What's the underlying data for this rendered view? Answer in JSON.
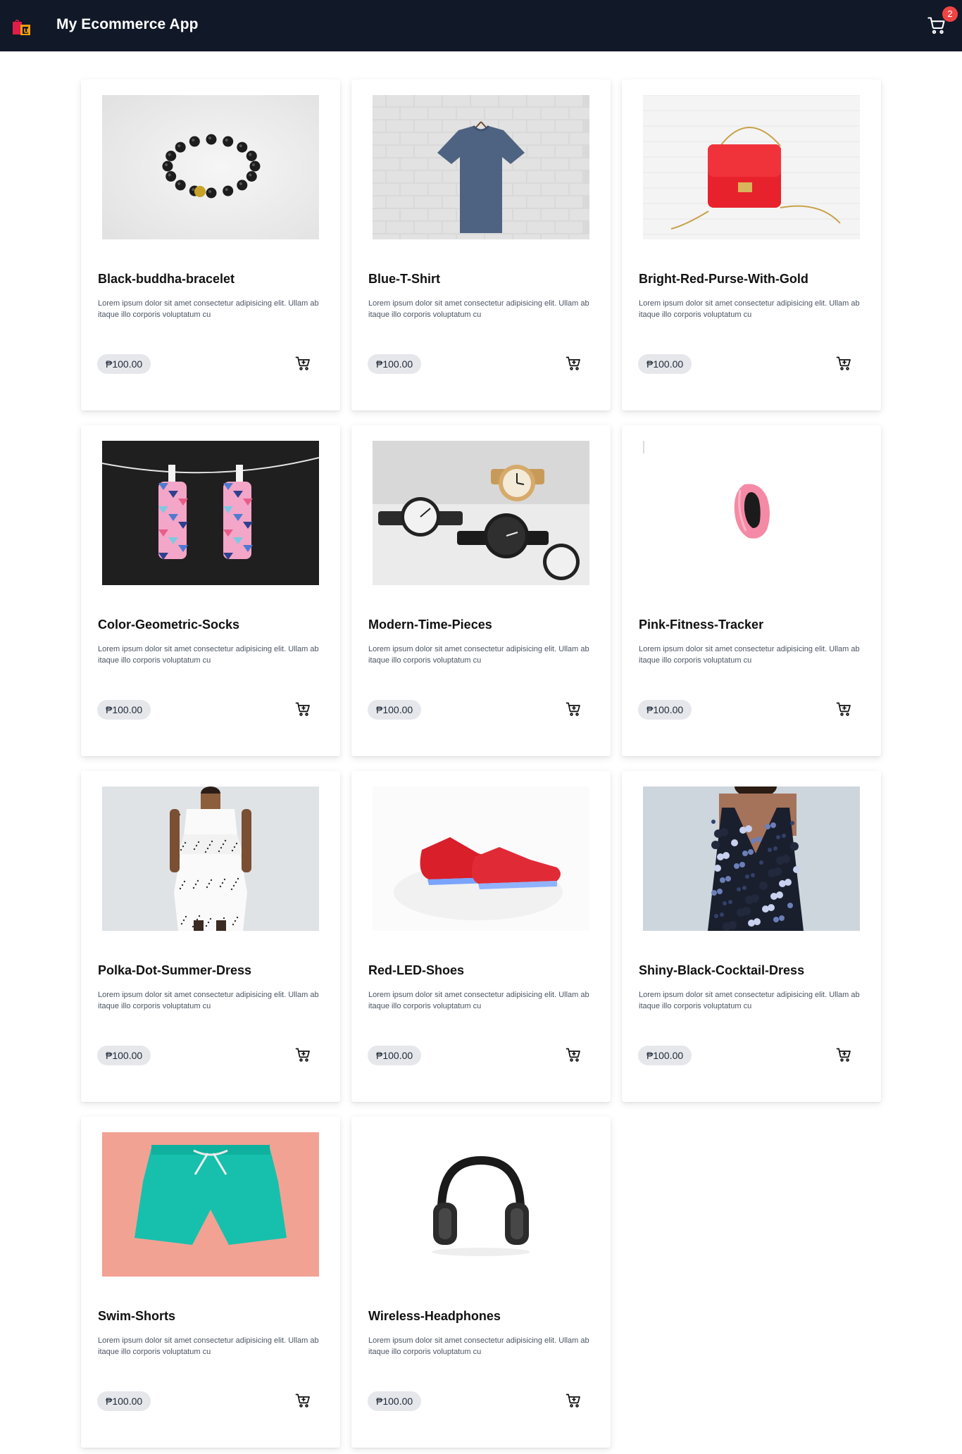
{
  "header": {
    "app_title": "My Ecommerce App",
    "cart_count": "2",
    "colors": {
      "background": "#111827",
      "badge": "#ef4444"
    }
  },
  "products": [
    {
      "name": "Black-buddha-bracelet",
      "description": "Lorem ipsum dolor sit amet consectetur adipisicing elit. Ullam ab itaque illo corporis voluptatum cu",
      "price": "₱100.00",
      "image_icon": "bracelet-image"
    },
    {
      "name": "Blue-T-Shirt",
      "description": "Lorem ipsum dolor sit amet consectetur adipisicing elit. Ullam ab itaque illo corporis voluptatum cu",
      "price": "₱100.00",
      "image_icon": "tshirt-image"
    },
    {
      "name": "Bright-Red-Purse-With-Gold",
      "description": "Lorem ipsum dolor sit amet consectetur adipisicing elit. Ullam ab itaque illo corporis voluptatum cu",
      "price": "₱100.00",
      "image_icon": "purse-image"
    },
    {
      "name": "Color-Geometric-Socks",
      "description": "Lorem ipsum dolor sit amet consectetur adipisicing elit. Ullam ab itaque illo corporis voluptatum cu",
      "price": "₱100.00",
      "image_icon": "socks-image"
    },
    {
      "name": "Modern-Time-Pieces",
      "description": "Lorem ipsum dolor sit amet consectetur adipisicing elit. Ullam ab itaque illo corporis voluptatum cu",
      "price": "₱100.00",
      "image_icon": "watches-image"
    },
    {
      "name": "Pink-Fitness-Tracker",
      "description": "Lorem ipsum dolor sit amet consectetur adipisicing elit. Ullam ab itaque illo corporis voluptatum cu",
      "price": "₱100.00",
      "image_icon": "fitness-tracker-image"
    },
    {
      "name": "Polka-Dot-Summer-Dress",
      "description": "Lorem ipsum dolor sit amet consectetur adipisicing elit. Ullam ab itaque illo corporis voluptatum cu",
      "price": "₱100.00",
      "image_icon": "dress-image"
    },
    {
      "name": "Red-LED-Shoes",
      "description": "Lorem ipsum dolor sit amet consectetur adipisicing elit. Ullam ab itaque illo corporis voluptatum cu",
      "price": "₱100.00",
      "image_icon": "shoes-image"
    },
    {
      "name": "Shiny-Black-Cocktail-Dress",
      "description": "Lorem ipsum dolor sit amet consectetur adipisicing elit. Ullam ab itaque illo corporis voluptatum cu",
      "price": "₱100.00",
      "image_icon": "cocktail-dress-image"
    },
    {
      "name": "Swim-Shorts",
      "description": "Lorem ipsum dolor sit amet consectetur adipisicing elit. Ullam ab itaque illo corporis voluptatum cu",
      "price": "₱100.00",
      "image_icon": "swim-shorts-image"
    },
    {
      "name": "Wireless-Headphones",
      "description": "Lorem ipsum dolor sit amet consectetur adipisicing elit. Ullam ab itaque illo corporis voluptatum cu",
      "price": "₱100.00",
      "image_icon": "headphones-image"
    }
  ]
}
